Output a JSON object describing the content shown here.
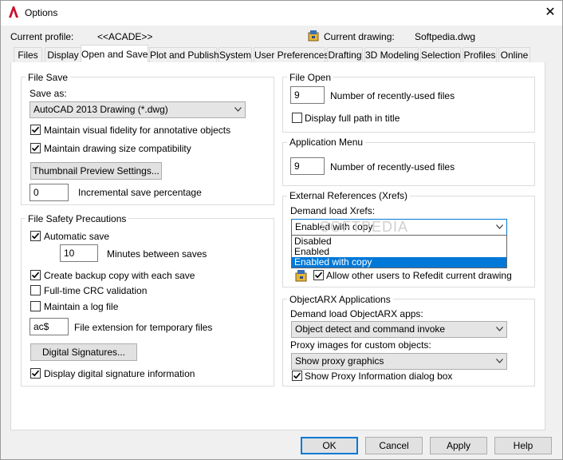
{
  "window": {
    "title": "Options"
  },
  "header": {
    "current_profile_label": "Current profile:",
    "current_profile_value": "<<ACADE>>",
    "current_drawing_label": "Current drawing:",
    "current_drawing_value": "Softpedia.dwg"
  },
  "tabs": [
    "Files",
    "Display",
    "Open and Save",
    "Plot and Publish",
    "System",
    "User Preferences",
    "Drafting",
    "3D Modeling",
    "Selection",
    "Profiles",
    "Online"
  ],
  "active_tab": "Open and Save",
  "file_save": {
    "title": "File Save",
    "save_as_label": "Save as:",
    "save_as_value": "AutoCAD 2013 Drawing (*.dwg)",
    "visual_fidelity": {
      "label": "Maintain visual fidelity for annotative objects",
      "checked": true
    },
    "drawing_size": {
      "label": "Maintain drawing size compatibility",
      "checked": true
    },
    "thumbnail_button": "Thumbnail Preview Settings...",
    "incremental_value": "0",
    "incremental_label": "Incremental save percentage"
  },
  "file_safety": {
    "title": "File Safety Precautions",
    "automatic_save": {
      "label": "Automatic save",
      "checked": true
    },
    "minutes_value": "10",
    "minutes_label": "Minutes between saves",
    "backup_copy": {
      "label": "Create backup copy with each save",
      "checked": true
    },
    "crc_validation": {
      "label": "Full-time CRC validation",
      "checked": false
    },
    "log_file": {
      "label": "Maintain a log file",
      "checked": false
    },
    "temp_ext_value": "ac$",
    "temp_ext_label": "File extension for temporary files",
    "digital_signatures_button": "Digital Signatures...",
    "display_signature": {
      "label": "Display digital signature information",
      "checked": true
    }
  },
  "file_open": {
    "title": "File Open",
    "recent_value": "9",
    "recent_label": "Number of recently-used files",
    "full_path": {
      "label": "Display full path in title",
      "checked": false
    }
  },
  "app_menu": {
    "title": "Application Menu",
    "recent_value": "9",
    "recent_label": "Number of recently-used files"
  },
  "xrefs": {
    "title": "External References (Xrefs)",
    "demand_load_label": "Demand load Xrefs:",
    "demand_load_value": "Enabled with copy",
    "dropdown_options": [
      "Disabled",
      "Enabled",
      "Enabled with copy"
    ],
    "selected_option": "Enabled with copy",
    "refedit": {
      "label": "Allow other users to Refedit current drawing",
      "checked": true
    }
  },
  "objectarx": {
    "title": "ObjectARX Applications",
    "demand_load_label": "Demand load ObjectARX apps:",
    "demand_load_value": "Object detect and command invoke",
    "proxy_label": "Proxy images for custom objects:",
    "proxy_value": "Show proxy graphics",
    "proxy_dialog": {
      "label": "Show Proxy Information dialog box",
      "checked": true
    }
  },
  "footer": {
    "ok": "OK",
    "cancel": "Cancel",
    "apply": "Apply",
    "help": "Help"
  },
  "watermark": "SOFTPEDIA",
  "colors": {
    "accent": "#0078d7",
    "app_icon": "#c8102e"
  }
}
